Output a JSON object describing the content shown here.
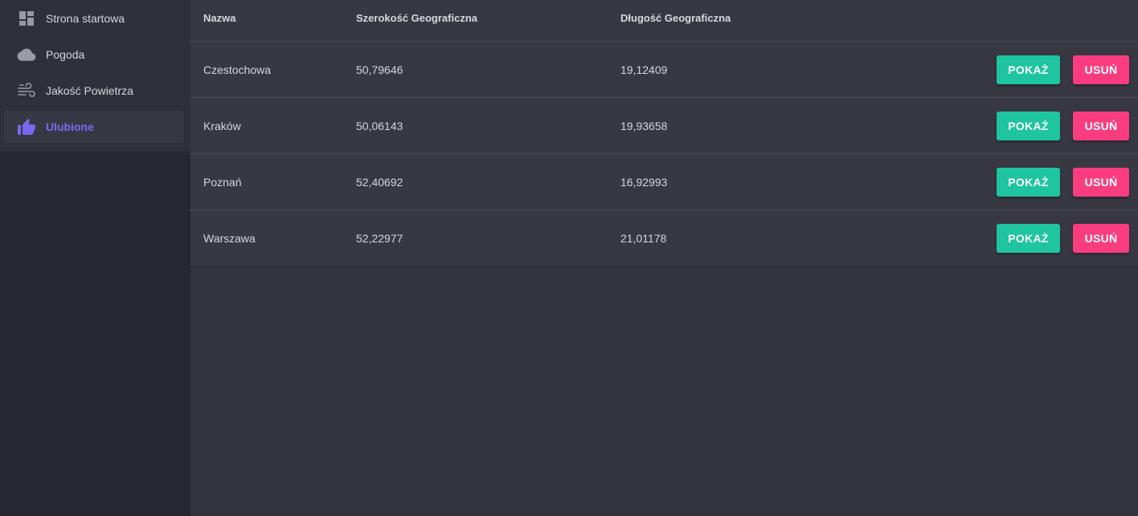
{
  "sidebar": {
    "items": [
      {
        "label": "Strona startowa",
        "icon": "dashboard-icon",
        "active": false
      },
      {
        "label": "Pogoda",
        "icon": "cloud-icon",
        "active": false
      },
      {
        "label": "Jakość Powietrza",
        "icon": "wind-icon",
        "active": false
      },
      {
        "label": "Ulubione",
        "icon": "thumb-up-icon",
        "active": true
      }
    ]
  },
  "table": {
    "headers": {
      "name": "Nazwa",
      "lat": "Szerokość Geograficzna",
      "lon": "Długość Geograficzna"
    },
    "rows": [
      {
        "name": "Czestochowa",
        "lat": "50,79646",
        "lon": "19,12409",
        "show": "POKAŻ",
        "delete": "USUŃ"
      },
      {
        "name": "Kraków",
        "lat": "50,06143",
        "lon": "19,93658",
        "show": "POKAŻ",
        "delete": "USUŃ"
      },
      {
        "name": "Poznań",
        "lat": "52,40692",
        "lon": "16,92993",
        "show": "POKAŻ",
        "delete": "USUŃ"
      },
      {
        "name": "Warszawa",
        "lat": "52,22977",
        "lon": "21,01178",
        "show": "POKAŻ",
        "delete": "USUŃ"
      }
    ]
  },
  "colors": {
    "accent": "#7b68ee",
    "show_button": "#1fc5a0",
    "delete_button": "#fb3d80"
  }
}
